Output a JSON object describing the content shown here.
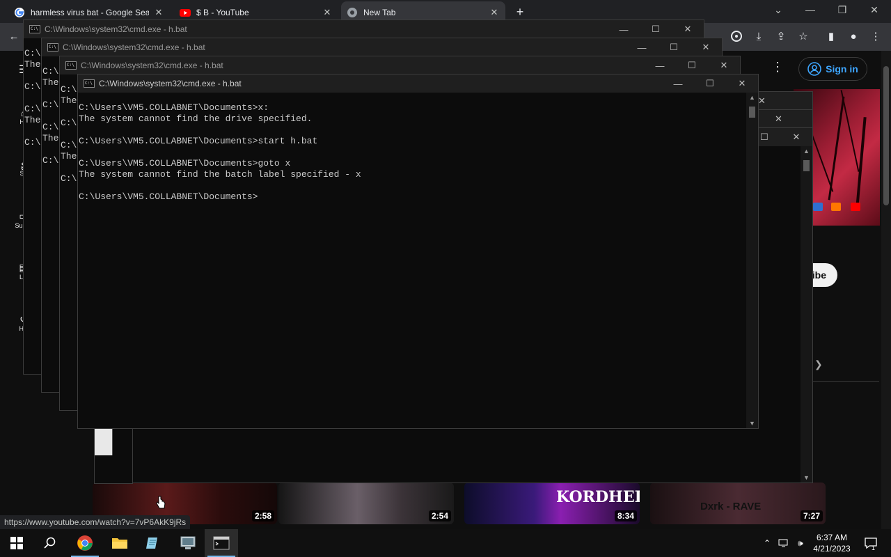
{
  "browser": {
    "tabs": [
      {
        "title": "harmless virus bat - Google Sear",
        "icon": "google-icon",
        "active": false
      },
      {
        "title": "$ B - YouTube",
        "icon": "youtube-icon",
        "active": false
      },
      {
        "title": "New Tab",
        "icon": "chrome-icon",
        "active": true
      }
    ],
    "new_tab_label": "+",
    "status_url": "https://www.youtube.com/watch?v=7vP6AkK9jRs"
  },
  "youtube": {
    "sign_in_label": "Sign in",
    "subscribe_partial": "ibe",
    "sidebar_partial": [
      "He",
      "Sh",
      "Subsc",
      "Lib",
      "His"
    ],
    "videos": [
      {
        "duration": "2:58"
      },
      {
        "duration": "2:54"
      },
      {
        "duration": "8:34",
        "overlay_text": "KORDHELL"
      },
      {
        "duration": "7:27",
        "overlay_text": "Dxrk - RAVE"
      }
    ]
  },
  "cmd_windows": [
    {
      "title": "C:\\Windows\\system32\\cmd.exe - h.bat",
      "partial_lines": [
        "C:\\",
        "The",
        "",
        "C:\\",
        "",
        "C:\\",
        "The",
        "",
        "C:\\"
      ]
    },
    {
      "title": "C:\\Windows\\system32\\cmd.exe - h.bat",
      "partial_lines": [
        "C:\\",
        "The",
        "",
        "C:\\",
        "",
        "C:\\",
        "The",
        "",
        "C:\\"
      ]
    },
    {
      "title": "C:\\Windows\\system32\\cmd.exe - h.bat",
      "partial_lines": [
        "C:\\",
        "The",
        "",
        "C:\\",
        "",
        "C:\\",
        "The",
        "",
        "C:\\"
      ]
    },
    {
      "title": "C:\\Windows\\system32\\cmd.exe - h.bat",
      "lines": [
        "C:\\Users\\VM5.COLLABNET\\Documents>x:",
        "The system cannot find the drive specified.",
        "",
        "C:\\Users\\VM5.COLLABNET\\Documents>start h.bat",
        "",
        "C:\\Users\\VM5.COLLABNET\\Documents>goto x",
        "The system cannot find the batch label specified - x",
        "",
        "C:\\Users\\VM5.COLLABNET\\Documents>"
      ]
    }
  ],
  "taskbar": {
    "time": "6:37 AM",
    "date": "4/21/2023",
    "notification_count": "1",
    "apps": [
      "start-icon",
      "search-icon",
      "chrome-icon",
      "file-explorer-icon",
      "notepad-icon",
      "control-panel-icon",
      "cmd-icon"
    ]
  }
}
